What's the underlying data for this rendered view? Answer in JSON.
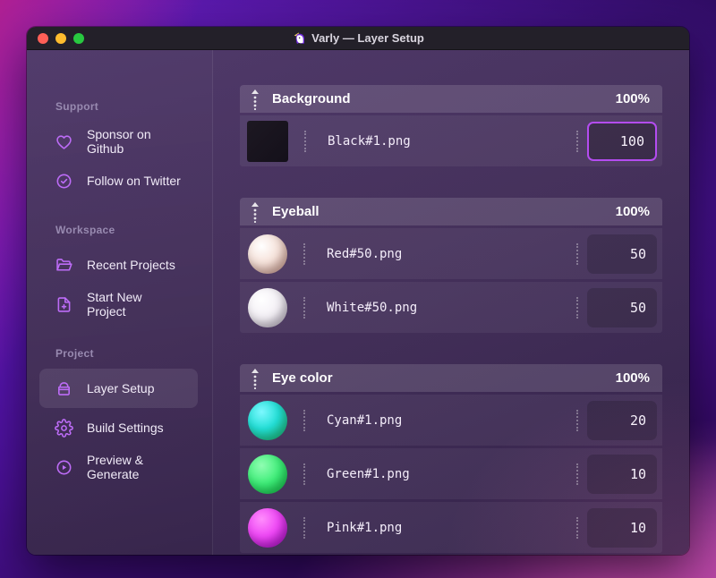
{
  "window": {
    "title": "Varly — Layer Setup",
    "app_icon": "unicorn-icon"
  },
  "titlebar": {
    "traffic_lights": [
      "close",
      "minimize",
      "zoom"
    ]
  },
  "colors": {
    "accent_purple": "#bd6cf7",
    "focus_border": "#b44cf0",
    "titlebar_bg": "#232029",
    "traffic_red": "#ff5f57",
    "traffic_yellow": "#febc2e",
    "traffic_green": "#28c840"
  },
  "sidebar": {
    "sections": [
      {
        "label": "Support",
        "items": [
          {
            "icon": "heart-icon",
            "label": "Sponsor on Github"
          },
          {
            "icon": "badge-check-icon",
            "label": "Follow on Twitter"
          }
        ]
      },
      {
        "label": "Workspace",
        "items": [
          {
            "icon": "folder-open-icon",
            "label": "Recent Projects"
          },
          {
            "icon": "file-plus-icon",
            "label": "Start New Project"
          }
        ]
      },
      {
        "label": "Project",
        "items": [
          {
            "icon": "layers-icon",
            "label": "Layer Setup",
            "active": true
          },
          {
            "icon": "gear-icon",
            "label": "Build Settings"
          },
          {
            "icon": "play-circle-icon",
            "label": "Preview & Generate"
          }
        ]
      }
    ]
  },
  "main": {
    "groups": [
      {
        "name": "Background",
        "opacity": "100%",
        "rows": [
          {
            "thumb": "black-square",
            "filename": "Black#1.png",
            "value": "100",
            "focused": true
          }
        ]
      },
      {
        "name": "Eyeball",
        "opacity": "100%",
        "rows": [
          {
            "thumb": "sphere-red",
            "filename": "Red#50.png",
            "value": "50"
          },
          {
            "thumb": "sphere-white",
            "filename": "White#50.png",
            "value": "50"
          }
        ]
      },
      {
        "name": "Eye color",
        "opacity": "100%",
        "rows": [
          {
            "thumb": "sphere-cyan",
            "filename": "Cyan#1.png",
            "value": "20"
          },
          {
            "thumb": "sphere-green",
            "filename": "Green#1.png",
            "value": "10"
          },
          {
            "thumb": "sphere-pink",
            "filename": "Pink#1.png",
            "value": "10"
          }
        ]
      }
    ]
  }
}
